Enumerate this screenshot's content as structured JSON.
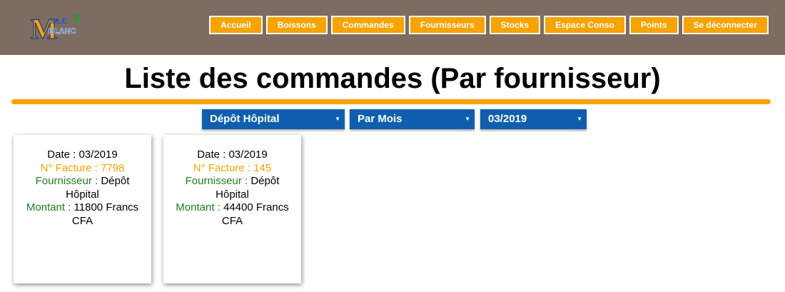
{
  "header": {
    "logo": {
      "letter": "M",
      "line1": "ILLE",
      "line2": "BLANC"
    },
    "nav": [
      {
        "label": "Accueil"
      },
      {
        "label": "Boissons"
      },
      {
        "label": "Commandes"
      },
      {
        "label": "Fournisseurs"
      },
      {
        "label": "Stocks"
      },
      {
        "label": "Espace Conso"
      },
      {
        "label": "Points"
      },
      {
        "label": "Se déconnecter"
      }
    ]
  },
  "page": {
    "title": "Liste des commandes (Par fournisseur)"
  },
  "filters": {
    "supplier": "Dépôt Hôpital",
    "period": "Par Mois",
    "month": "03/2019"
  },
  "orders": [
    {
      "date_label": "Date : ",
      "date": "03/2019",
      "invoice_label": "N° Facture : ",
      "invoice": "7798",
      "supplier_label": "Fournisseur : ",
      "supplier": "Dépôt Hôpital",
      "amount_label": "Montant : ",
      "amount": "11800 Francs CFA"
    },
    {
      "date_label": "Date : ",
      "date": "03/2019",
      "invoice_label": "N° Facture : ",
      "invoice": "145",
      "supplier_label": "Fournisseur : ",
      "supplier": "Dépôt Hôpital",
      "amount_label": "Montant : ",
      "amount": "44400 Francs CFA"
    }
  ],
  "colors": {
    "header_bg": "#7d6c62",
    "accent_orange": "#f7a300",
    "select_blue": "#0f5fae",
    "label_green": "#1e7d1e"
  }
}
